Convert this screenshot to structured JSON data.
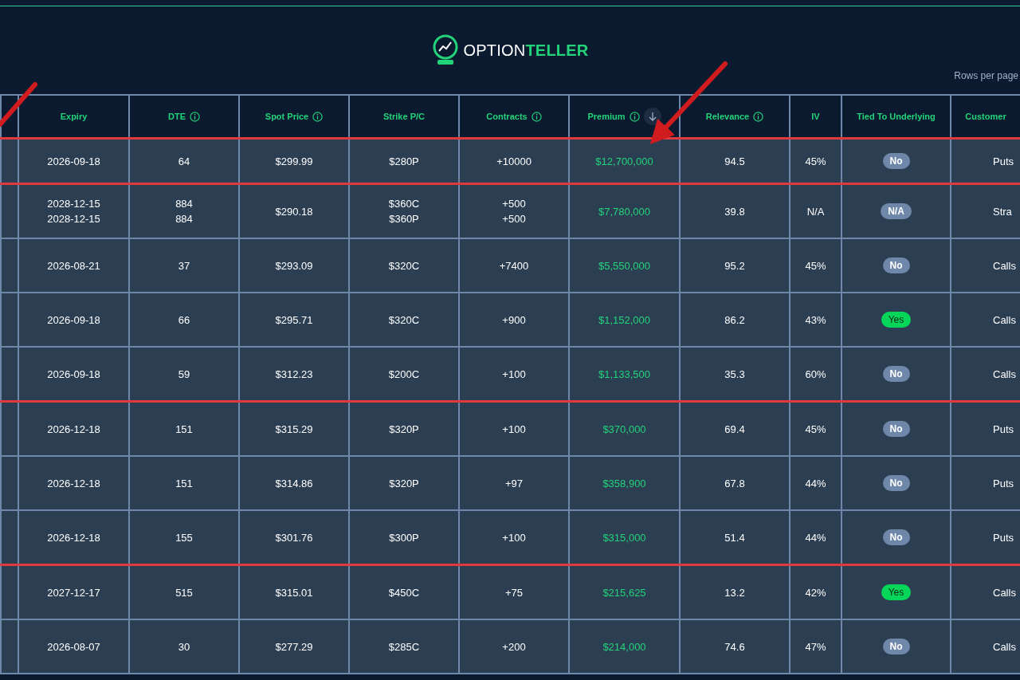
{
  "logo": {
    "first": "OPTION",
    "second": "TELLER"
  },
  "rows_per_page": {
    "label": "Rows per page"
  },
  "columns": [
    {
      "label": "Expiry",
      "info": false,
      "sorted": false
    },
    {
      "label": "DTE",
      "info": true,
      "sorted": false
    },
    {
      "label": "Spot Price",
      "info": true,
      "sorted": false
    },
    {
      "label": "Strike P/C",
      "info": false,
      "sorted": false
    },
    {
      "label": "Contracts",
      "info": true,
      "sorted": false
    },
    {
      "label": "Premium",
      "info": true,
      "sorted": true
    },
    {
      "label": "Relevance",
      "info": true,
      "sorted": false
    },
    {
      "label": "IV",
      "info": false,
      "sorted": false
    },
    {
      "label": "Tied To Underlying",
      "info": false,
      "sorted": false
    },
    {
      "label": "Customer",
      "info": false,
      "sorted": false
    }
  ],
  "header_highlight_below": true,
  "rows": [
    {
      "expiry": [
        "2026-09-18"
      ],
      "dte": [
        "64"
      ],
      "spot": "$299.99",
      "strike": [
        "$280P"
      ],
      "contracts": [
        "+10000"
      ],
      "premium": "$12,700,000",
      "relevance": "94.5",
      "iv": "45%",
      "tied": {
        "text": "No",
        "positive": false
      },
      "customer": "Puts",
      "highlight_below": true
    },
    {
      "expiry": [
        "2028-12-15",
        "2028-12-15"
      ],
      "dte": [
        "884",
        "884"
      ],
      "spot": "$290.18",
      "strike": [
        "$360C",
        "$360P"
      ],
      "contracts": [
        "+500",
        "+500"
      ],
      "premium": "$7,780,000",
      "relevance": "39.8",
      "iv": "N/A",
      "tied": {
        "text": "N/A",
        "positive": false
      },
      "customer": "Stra",
      "highlight_below": false
    },
    {
      "expiry": [
        "2026-08-21"
      ],
      "dte": [
        "37"
      ],
      "spot": "$293.09",
      "strike": [
        "$320C"
      ],
      "contracts": [
        "+7400"
      ],
      "premium": "$5,550,000",
      "relevance": "95.2",
      "iv": "45%",
      "tied": {
        "text": "No",
        "positive": false
      },
      "customer": "Calls",
      "highlight_below": false
    },
    {
      "expiry": [
        "2026-09-18"
      ],
      "dte": [
        "66"
      ],
      "spot": "$295.71",
      "strike": [
        "$320C"
      ],
      "contracts": [
        "+900"
      ],
      "premium": "$1,152,000",
      "relevance": "86.2",
      "iv": "43%",
      "tied": {
        "text": "Yes",
        "positive": true
      },
      "customer": "Calls",
      "highlight_below": false
    },
    {
      "expiry": [
        "2026-09-18"
      ],
      "dte": [
        "59"
      ],
      "spot": "$312.23",
      "strike": [
        "$200C"
      ],
      "contracts": [
        "+100"
      ],
      "premium": "$1,133,500",
      "relevance": "35.3",
      "iv": "60%",
      "tied": {
        "text": "No",
        "positive": false
      },
      "customer": "Calls",
      "highlight_below": true
    },
    {
      "expiry": [
        "2026-12-18"
      ],
      "dte": [
        "151"
      ],
      "spot": "$315.29",
      "strike": [
        "$320P"
      ],
      "contracts": [
        "+100"
      ],
      "premium": "$370,000",
      "relevance": "69.4",
      "iv": "45%",
      "tied": {
        "text": "No",
        "positive": false
      },
      "customer": "Puts",
      "highlight_below": false
    },
    {
      "expiry": [
        "2026-12-18"
      ],
      "dte": [
        "151"
      ],
      "spot": "$314.86",
      "strike": [
        "$320P"
      ],
      "contracts": [
        "+97"
      ],
      "premium": "$358,900",
      "relevance": "67.8",
      "iv": "44%",
      "tied": {
        "text": "No",
        "positive": false
      },
      "customer": "Puts",
      "highlight_below": false
    },
    {
      "expiry": [
        "2026-12-18"
      ],
      "dte": [
        "155"
      ],
      "spot": "$301.76",
      "strike": [
        "$300P"
      ],
      "contracts": [
        "+100"
      ],
      "premium": "$315,000",
      "relevance": "51.4",
      "iv": "44%",
      "tied": {
        "text": "No",
        "positive": false
      },
      "customer": "Puts",
      "highlight_below": true
    },
    {
      "expiry": [
        "2027-12-17"
      ],
      "dte": [
        "515"
      ],
      "spot": "$315.01",
      "strike": [
        "$450C"
      ],
      "contracts": [
        "+75"
      ],
      "premium": "$215,625",
      "relevance": "13.2",
      "iv": "42%",
      "tied": {
        "text": "Yes",
        "positive": true
      },
      "customer": "Calls",
      "highlight_below": false
    },
    {
      "expiry": [
        "2026-08-07"
      ],
      "dte": [
        "30"
      ],
      "spot": "$277.29",
      "strike": [
        "$285C"
      ],
      "contracts": [
        "+200"
      ],
      "premium": "$214,000",
      "relevance": "74.6",
      "iv": "47%",
      "tied": {
        "text": "No",
        "positive": false
      },
      "customer": "Calls",
      "highlight_below": false
    }
  ]
}
